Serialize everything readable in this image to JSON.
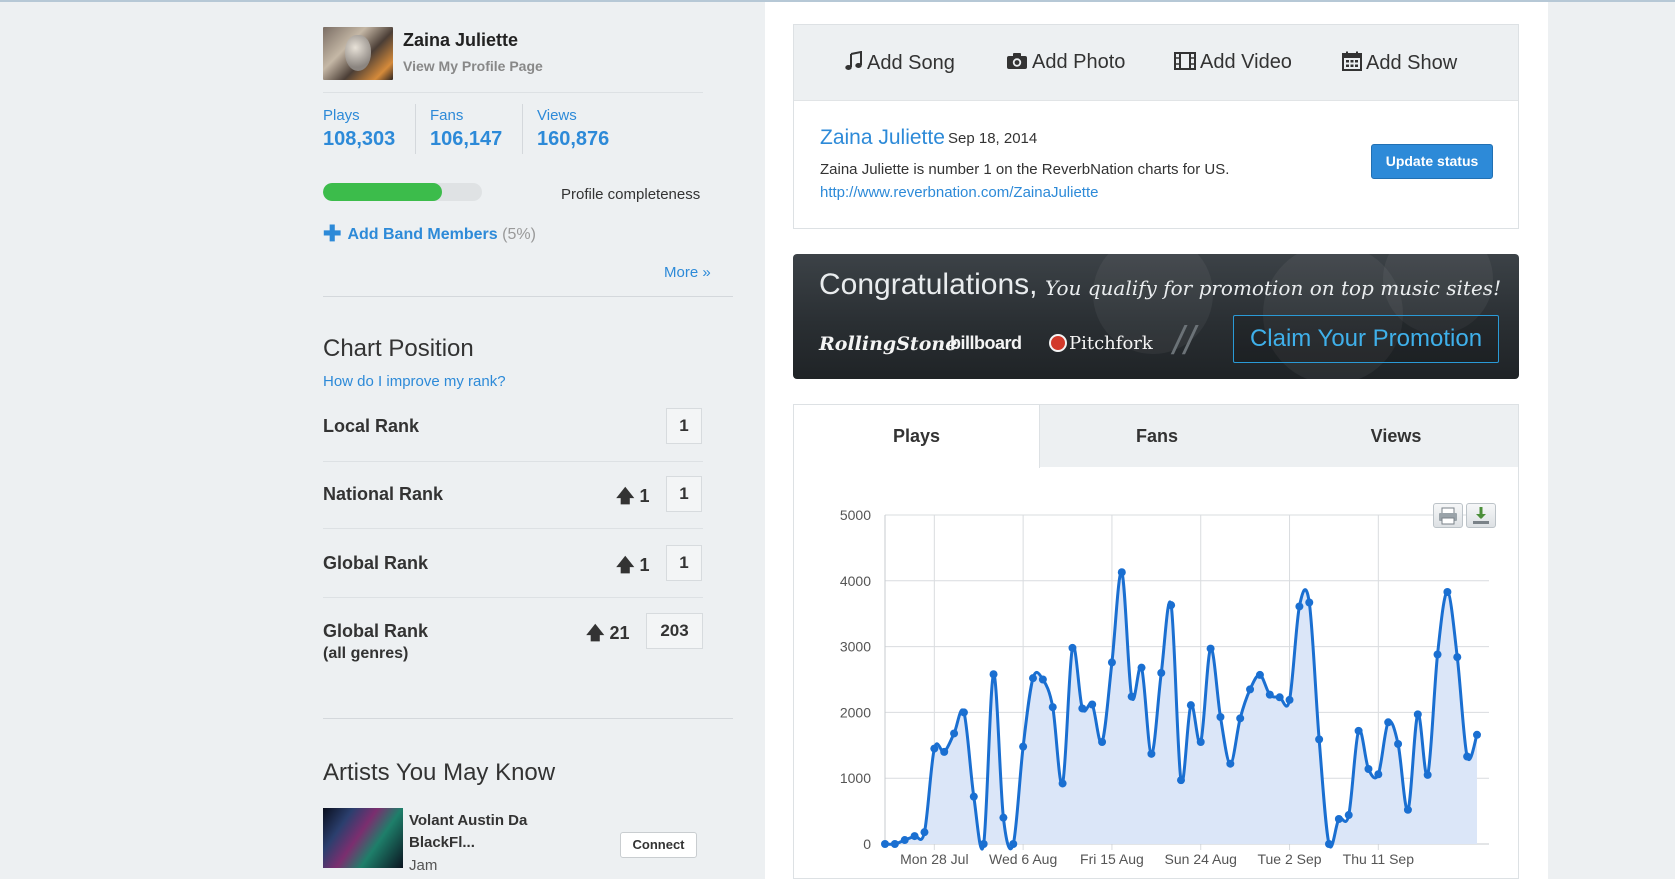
{
  "profile": {
    "name": "Zaina Juliette",
    "view_link": "View My Profile Page",
    "stats": [
      {
        "label": "Plays",
        "value": "108,303"
      },
      {
        "label": "Fans",
        "value": "106,147"
      },
      {
        "label": "Views",
        "value": "160,876"
      }
    ],
    "completeness_label": "Profile completeness",
    "completeness_fraction": 0.75,
    "add_band_members": "Add Band Members",
    "add_band_pct": "(5%)",
    "more_link": "More »"
  },
  "chart_position": {
    "title": "Chart Position",
    "improve_link": "How do I improve my rank?",
    "ranks": [
      {
        "label": "Local Rank",
        "sub": "",
        "change": "",
        "value": "1"
      },
      {
        "label": "National Rank",
        "sub": "",
        "change": "1",
        "value": "1"
      },
      {
        "label": "Global Rank",
        "sub": "",
        "change": "1",
        "value": "1"
      },
      {
        "label": "Global Rank",
        "sub": "(all genres)",
        "change": "21",
        "value": "203"
      }
    ]
  },
  "artists": {
    "title": "Artists You May Know",
    "items": [
      {
        "name": "Volant Austin Da BlackFl...",
        "genre": "Jam",
        "button": "Connect"
      }
    ]
  },
  "toolbar": {
    "add_song": "Add Song",
    "add_photo": "Add Photo",
    "add_video": "Add Video",
    "add_show": "Add Show"
  },
  "status": {
    "name": "Zaina Juliette",
    "date": "Sep 18, 2014",
    "text": "Zaina Juliette is number 1 on the ReverbNation charts for US.",
    "url": "http://www.reverbnation.com/ZainaJuliette",
    "update_button": "Update status"
  },
  "promo": {
    "headline": "Congratulations,",
    "subline": "You qualify for promotion on top music sites!",
    "logos": [
      "RollingStone",
      "billboard",
      "Pitchfork"
    ],
    "button": "Claim Your Promotion"
  },
  "tabs": [
    "Plays",
    "Fans",
    "Views"
  ],
  "colors": {
    "accent": "#2d8ad8",
    "progress": "#3cbc4b",
    "chart_line": "#1a6fd1",
    "chart_fill": "#dbe6f8"
  },
  "icons": [
    "music-note-icon",
    "camera-icon",
    "film-icon",
    "calendar-icon",
    "arrow-up-icon",
    "plus-icon",
    "print-icon",
    "download-icon"
  ],
  "chart_data": {
    "type": "area",
    "title": "",
    "xlabel": "",
    "ylabel": "",
    "ylim": [
      0,
      5000
    ],
    "yticks": [
      0,
      1000,
      2000,
      3000,
      4000,
      5000
    ],
    "xtick_labels": [
      "Mon 28 Jul",
      "Wed 6 Aug",
      "Fri 15 Aug",
      "Sun 24 Aug",
      "Tue 2 Sep",
      "Thu 11 Sep"
    ],
    "xtick_index": [
      5,
      14,
      23,
      32,
      41,
      50
    ],
    "grid": true,
    "series": [
      {
        "name": "",
        "values": [
          0,
          0,
          60,
          120,
          180,
          1450,
          1400,
          1680,
          2000,
          720,
          0,
          2580,
          400,
          0,
          1480,
          2520,
          2500,
          2080,
          920,
          2980,
          2060,
          2120,
          1550,
          2760,
          4130,
          2240,
          2680,
          1370,
          2600,
          3630,
          970,
          2110,
          1550,
          2970,
          1930,
          1220,
          1910,
          2350,
          2570,
          2270,
          2230,
          2190,
          3610,
          3670,
          1590,
          0,
          380,
          440,
          1720,
          1140,
          1060,
          1850,
          1520,
          520,
          1970,
          1050,
          2880,
          3830,
          2840,
          1330,
          1660
        ]
      }
    ]
  }
}
